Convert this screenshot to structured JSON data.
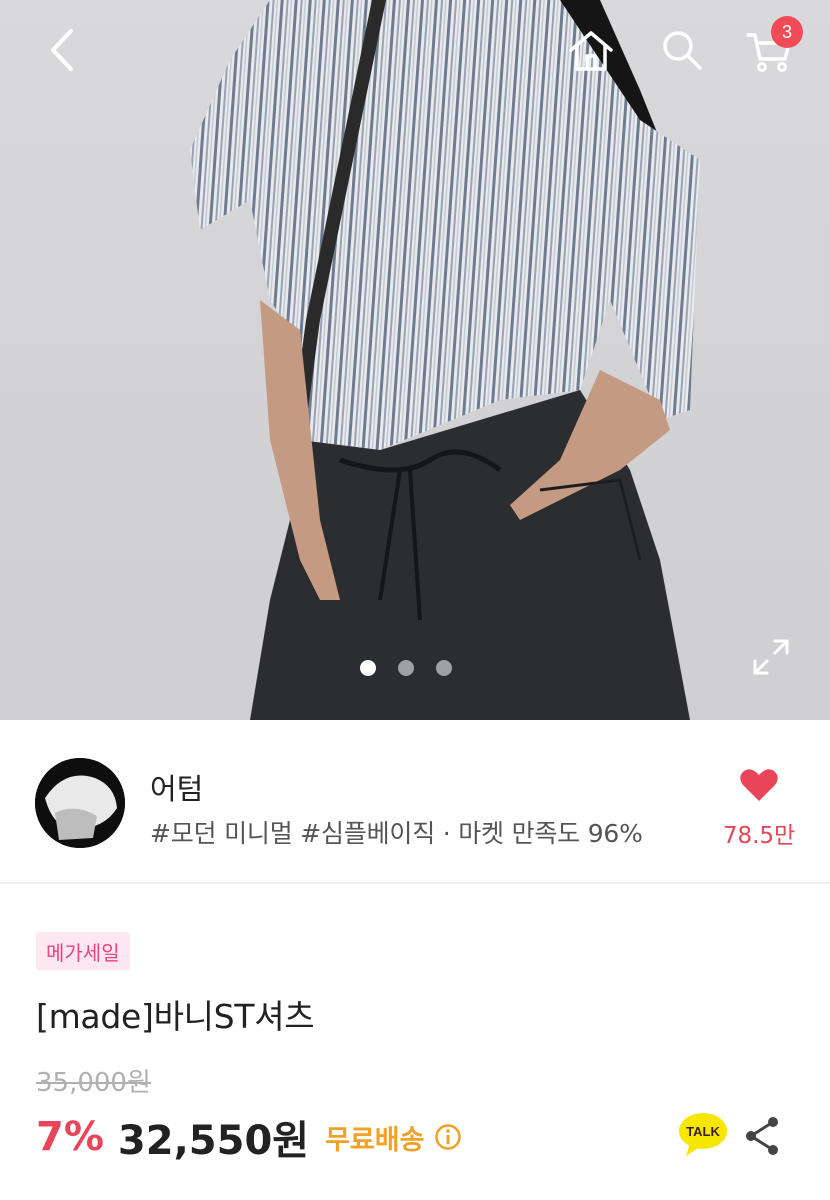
{
  "header": {
    "cart_count": "3",
    "icons": [
      "back-icon",
      "home-icon",
      "search-icon",
      "cart-icon",
      "expand-icon"
    ]
  },
  "gallery": {
    "total_images": 3,
    "current_index": 1
  },
  "shop": {
    "name": "어텀",
    "tags": "#모던 미니멀 #심플베이직 · 마켓 만족도 96%",
    "like_count": "78.5만"
  },
  "product": {
    "badge": "메가세일",
    "title": "[made]바니ST셔츠",
    "original_price": "35,000원",
    "discount": "7%",
    "price": "32,550원",
    "shipping": "무료배송",
    "talk_label": "TALK"
  },
  "colors": {
    "accent_red": "#e8455a",
    "badge_pink": "#e8457f",
    "shipping_orange": "#f1a028",
    "talk_yellow": "#f7e600"
  }
}
